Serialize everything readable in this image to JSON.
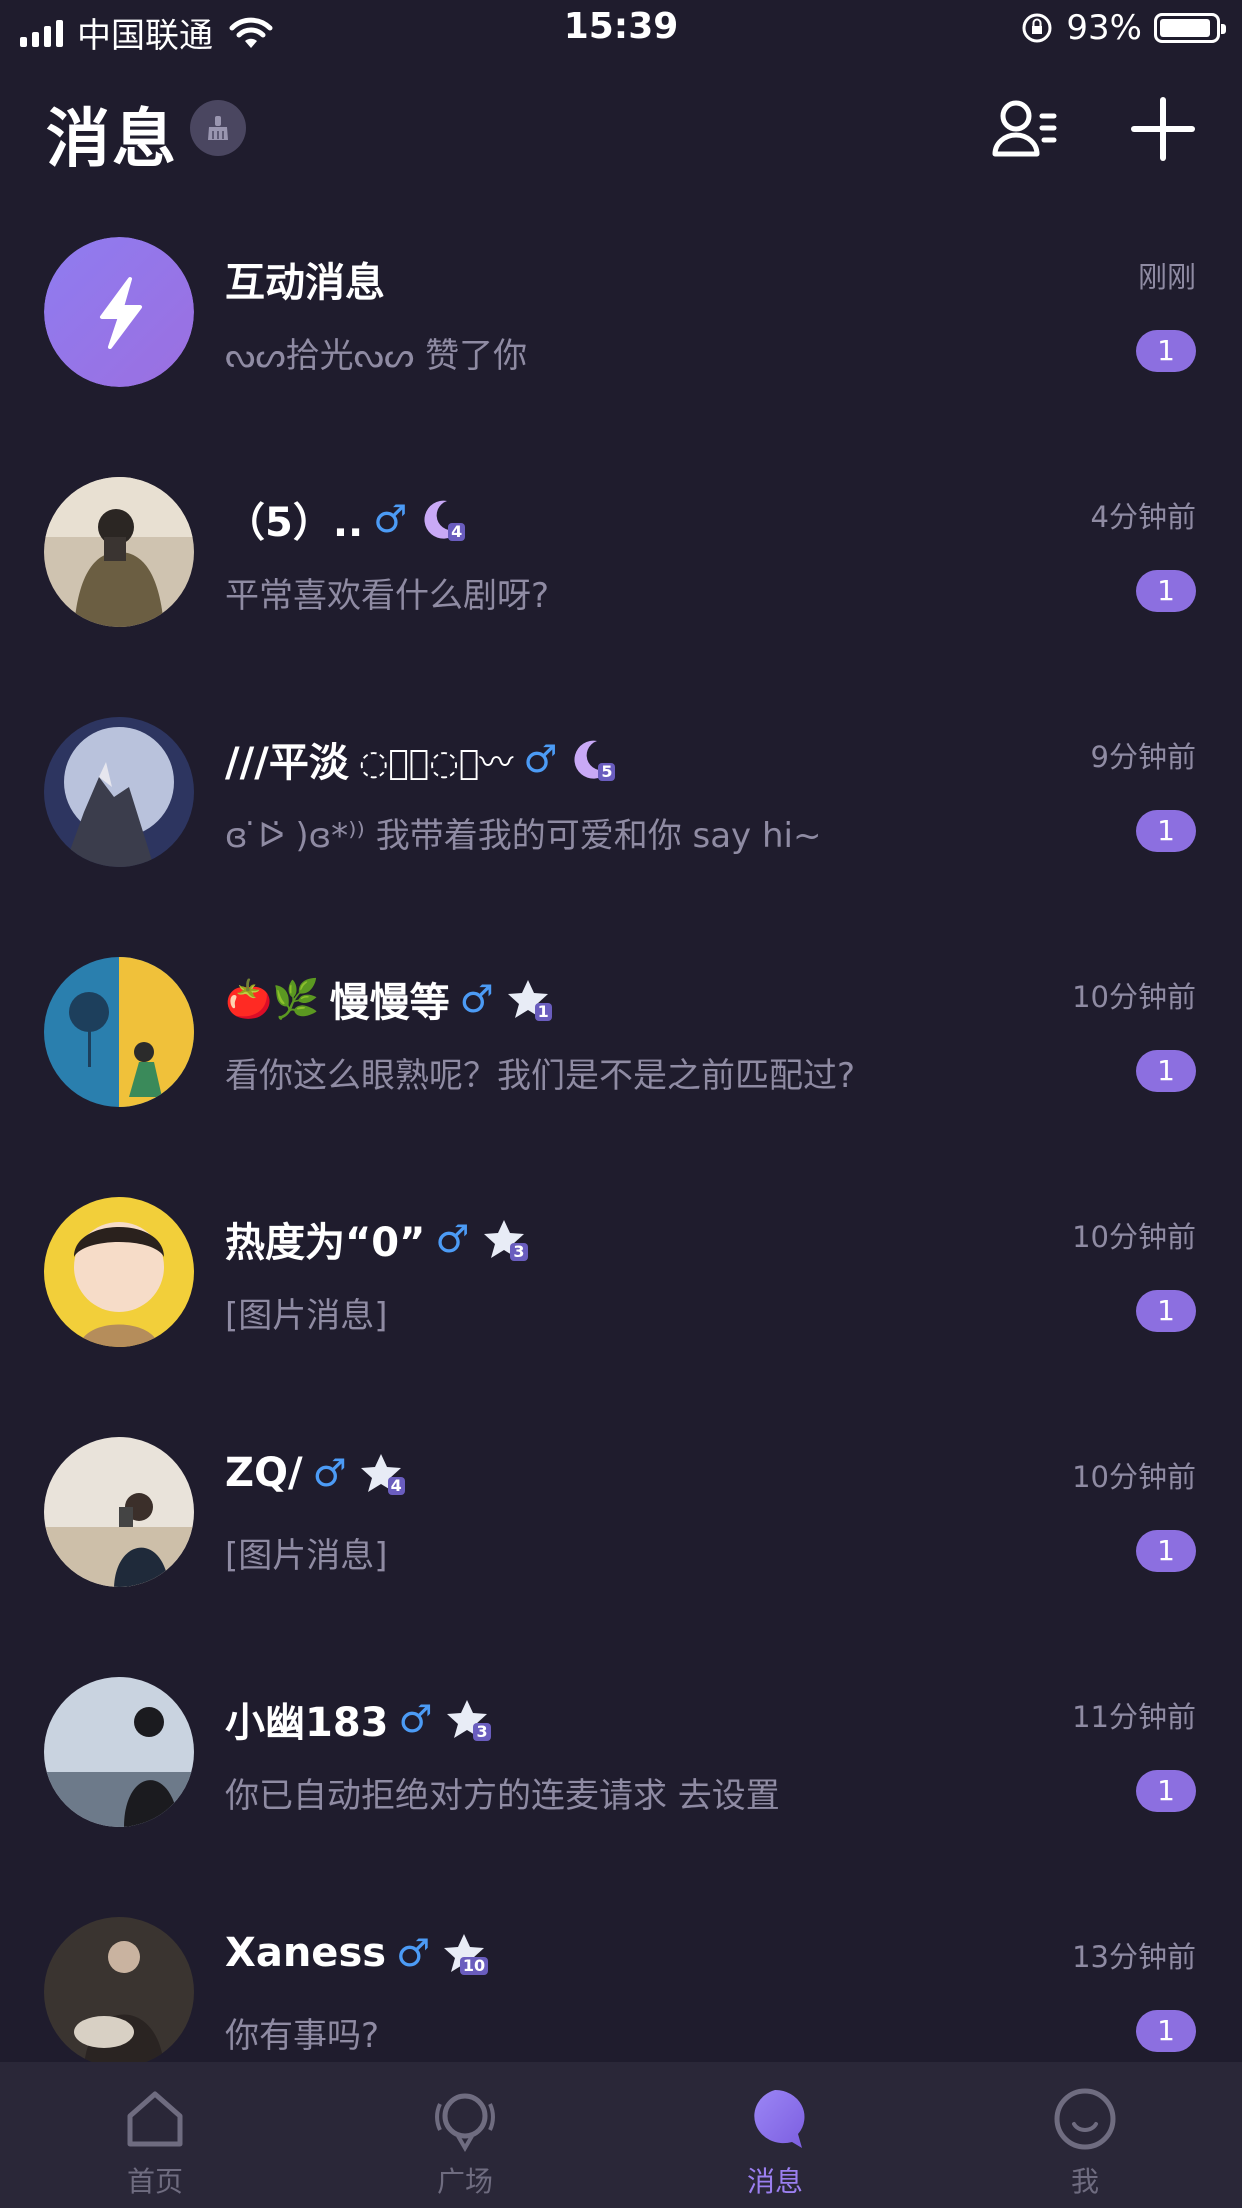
{
  "status_bar": {
    "carrier": "中国联通",
    "time": "15:39",
    "battery_percent": "93%",
    "battery_level": 0.93
  },
  "header": {
    "title": "消息",
    "clean_icon": "broom-icon",
    "contacts_icon": "contacts-list-icon",
    "add_icon": "plus-icon"
  },
  "messages": [
    {
      "name": "互动消息",
      "preview": "ᔓᔕ拾光ᔓᔕ 赞了你",
      "time": "刚刚",
      "badge": "1"
    },
    {
      "name": "（5）..",
      "preview": "平常喜欢看什么剧呀?",
      "time": "4分钟前",
      "badge": "1",
      "level": "4"
    },
    {
      "name": "///平淡",
      "name_deco": "◌ᩚ⃟◌ᩚ〰",
      "preview": "ɞ ̇ᐅ̇ )ɞ*⁾⁾ 我带着我的可爱和你 say hi~",
      "time": "9分钟前",
      "badge": "1",
      "level": "5"
    },
    {
      "name": "慢慢等",
      "name_prefix": "🍅🌿",
      "preview": "看你这么眼熟呢？我们是不是之前匹配过?",
      "time": "10分钟前",
      "badge": "1",
      "level": "1"
    },
    {
      "name": "热度为“0”",
      "preview": "[图片消息]",
      "time": "10分钟前",
      "badge": "1",
      "level": "3"
    },
    {
      "name": "ZQ/",
      "preview": "[图片消息]",
      "time": "10分钟前",
      "badge": "1",
      "level": "4"
    },
    {
      "name": "小幽183",
      "preview": "你已自动拒绝对方的连麦请求 去设置",
      "time": "11分钟前",
      "badge": "1",
      "level": "3"
    },
    {
      "name": "Xaness",
      "preview": "你有事吗?",
      "time": "13分钟前",
      "badge": "1",
      "level": "10"
    }
  ],
  "gender_symbol": "♂",
  "tabs": [
    {
      "label": "首页",
      "icon": "home-icon"
    },
    {
      "label": "广场",
      "icon": "plaza-icon"
    },
    {
      "label": "消息",
      "icon": "message-icon",
      "active": true
    },
    {
      "label": "我",
      "icon": "profile-icon"
    }
  ],
  "colors": {
    "background": "#1f1c2d",
    "accent": "#8c6fe0",
    "gender_male": "#4c9bf5",
    "secondary_text": "#8f8ba3"
  }
}
